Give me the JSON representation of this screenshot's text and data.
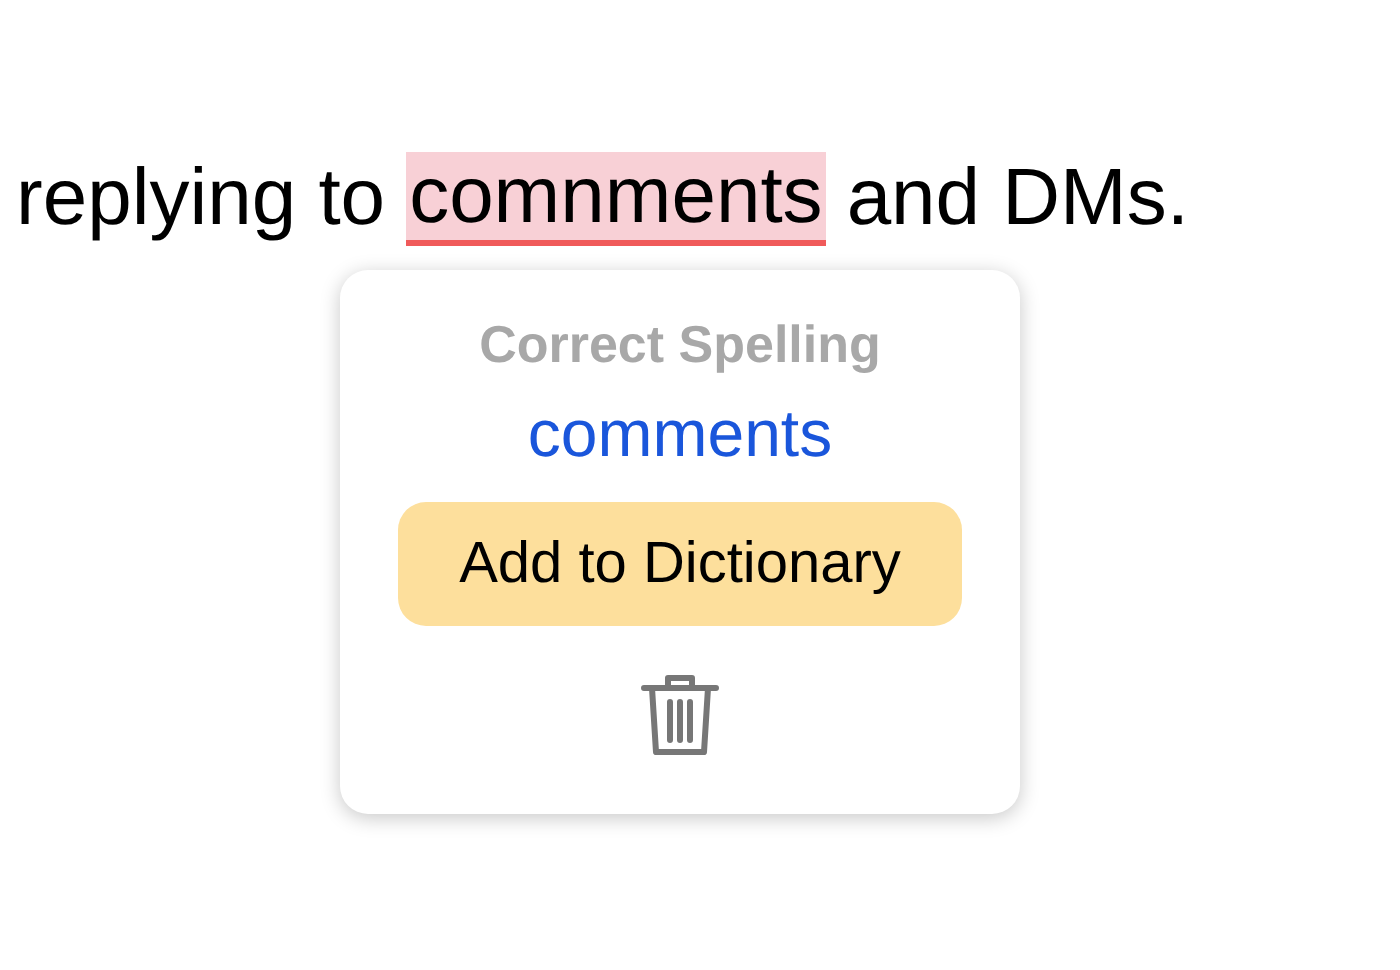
{
  "sentence": {
    "before": "replying to",
    "misspelled": "comnments",
    "after": "and DMs."
  },
  "popup": {
    "title": "Correct Spelling",
    "items": [
      {
        "kind": "suggestion",
        "text": "comments",
        "selected": false
      },
      {
        "kind": "action",
        "text": "Add to Dictionary",
        "selected": true
      }
    ],
    "delete": true
  }
}
